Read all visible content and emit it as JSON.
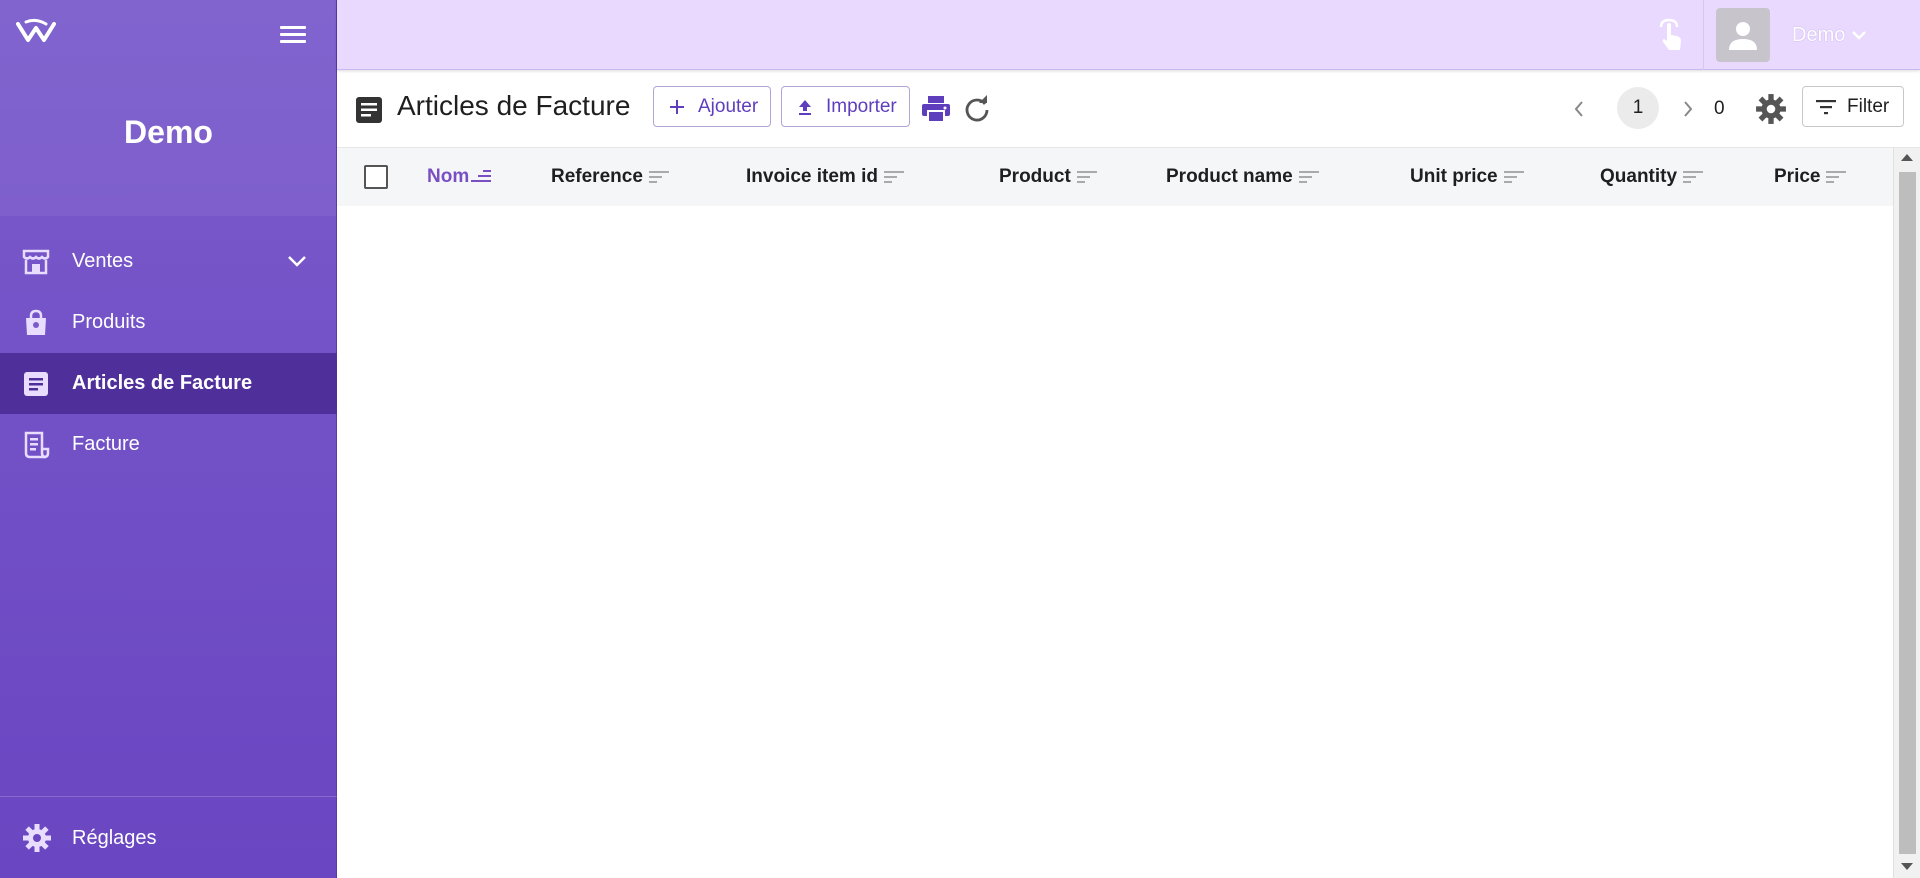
{
  "sidebar": {
    "brand": "Demo",
    "items": [
      {
        "label": "Ventes",
        "icon": "store-icon",
        "has_submenu": true
      },
      {
        "label": "Produits",
        "icon": "shopping-bag-icon"
      },
      {
        "label": "Articles de Facture",
        "icon": "document-icon",
        "active": true
      },
      {
        "label": "Facture",
        "icon": "receipt-icon"
      }
    ],
    "settings_label": "Réglages"
  },
  "topbar": {
    "user_name": "Demo"
  },
  "toolbar": {
    "title": "Articles de Facture",
    "add_label": "Ajouter",
    "import_label": "Importer",
    "current_page": "1",
    "total_count": "0",
    "filter_label": "Filter"
  },
  "table": {
    "columns": [
      {
        "label": "Nom",
        "sorted": true
      },
      {
        "label": "Reference"
      },
      {
        "label": "Invoice item id"
      },
      {
        "label": "Product"
      },
      {
        "label": "Product name"
      },
      {
        "label": "Unit price"
      },
      {
        "label": "Quantity"
      },
      {
        "label": "Price"
      }
    ],
    "rows": []
  },
  "colors": {
    "sidebar_bg": "#7a5bcb",
    "sidebar_active": "#4f309a",
    "topbar_bg": "#e9d9ff",
    "accent": "#5f3ebd"
  }
}
